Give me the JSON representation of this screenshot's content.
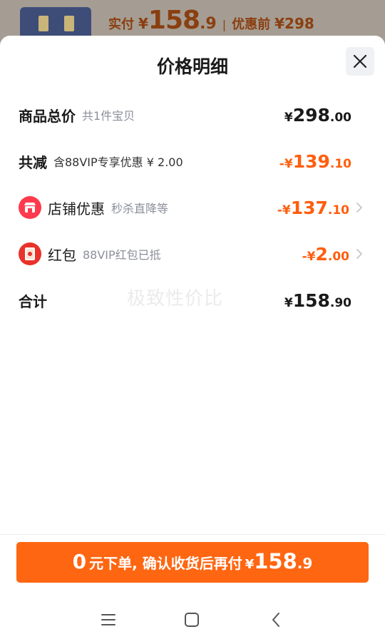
{
  "background": {
    "paid_label": "实付",
    "currency": "¥",
    "paid_int": "158",
    "paid_dec": ".9",
    "separator": "|",
    "orig_label": "优惠前",
    "orig_price": "¥298"
  },
  "sheet": {
    "title": "价格明细",
    "close_icon": "close-icon"
  },
  "rows": {
    "total": {
      "label": "商品总价",
      "sub": "共1件宝贝",
      "currency": "¥",
      "int": "298",
      "dec": ".00"
    },
    "discount": {
      "label": "共减",
      "sub": "含88VIP专享优惠 ¥ 2.00",
      "currency": "-¥",
      "int": "139",
      "dec": ".10"
    },
    "shop": {
      "label": "店铺优惠",
      "sub": "秒杀直降等",
      "icon": "shop-icon",
      "currency": "-¥",
      "int": "137",
      "dec": ".10"
    },
    "redpack": {
      "label": "红包",
      "sub": "88VIP红包已抵",
      "icon": "red-envelope-icon",
      "currency": "-¥",
      "int": "2",
      "dec": ".00"
    },
    "sum": {
      "label": "合计",
      "currency": "¥",
      "int": "158",
      "dec": ".90"
    }
  },
  "watermark": "极致性价比",
  "cta": {
    "zero": "0",
    "text": "元下单, 确认收货后再付",
    "currency": "¥",
    "int": "158",
    "dec": ".9"
  },
  "colors": {
    "accent": "#ff6611",
    "discount": "#ff5e0e",
    "shop_icon": "#ff3a4d",
    "redpack_icon": "#e8322a"
  },
  "navbar": {
    "menu_icon": "menu-icon",
    "home_icon": "home-square-icon",
    "back_icon": "back-arrow-icon"
  }
}
